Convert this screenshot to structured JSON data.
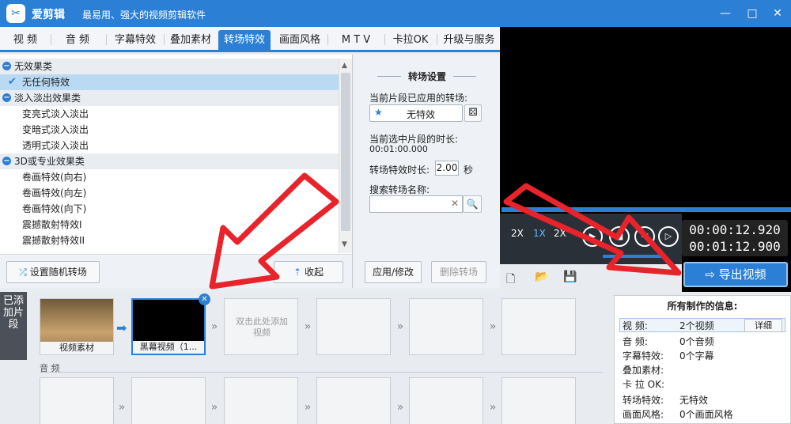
{
  "app": {
    "name": "爱剪辑",
    "slogan": "最易用、强大的视频剪辑软件"
  },
  "tabs": [
    "视 频",
    "音 频",
    "字幕特效",
    "叠加素材",
    "转场特效",
    "画面风格",
    "M T V",
    "卡拉OK",
    "升级与服务"
  ],
  "effects": {
    "group1": "无效果类",
    "g1_items": [
      "无任何特效"
    ],
    "group2": "淡入淡出效果类",
    "g2_items": [
      "变亮式淡入淡出",
      "变暗式淡入淡出",
      "透明式淡入淡出"
    ],
    "group3": "3D或专业效果类",
    "g3_items": [
      "卷画特效(向右)",
      "卷画特效(向左)",
      "卷画特效(向下)",
      "震撼散射特效I",
      "震撼散射特效II"
    ]
  },
  "buttons": {
    "random": "设置随机转场",
    "collapse": "收起",
    "apply": "应用/修改",
    "delete": "删除转场",
    "export": "导出视频",
    "detail": "详细"
  },
  "settings": {
    "title": "转场设置",
    "applied_label": "当前片段已应用的转场:",
    "applied_value": "无特效",
    "duration_label": "当前选中片段的时长:",
    "duration_value": "00:01:00.000",
    "effect_dur_label": "转场特效时长:",
    "effect_dur_value": "2.00",
    "sec": "秒",
    "search_label": "搜索转场名称:"
  },
  "player": {
    "time_current": "00:00:12.920",
    "time_total": "00:01:12.900",
    "speeds": [
      "2X",
      "1X",
      "2X"
    ]
  },
  "timeline": {
    "side_label": "已添加片段",
    "clip1": "视频素材",
    "clip2": "黑幕视频（1...",
    "add_hint": "双击此处添加视频",
    "audio_label": "音 频"
  },
  "info": {
    "title": "所有制作的信息:",
    "rows": [
      {
        "k": "视    频:",
        "v": "2个视频"
      },
      {
        "k": "音    频:",
        "v": "0个音频"
      },
      {
        "k": "字幕特效:",
        "v": "0个字幕"
      },
      {
        "k": "叠加素材:",
        "v": ""
      },
      {
        "k": "卡 拉 OK:",
        "v": ""
      },
      {
        "k": "转场特效:",
        "v": "无特效"
      },
      {
        "k": "画面风格:",
        "v": "0个画面风格"
      }
    ]
  },
  "colors": {
    "accent": "#2b7fd4",
    "arrow": "#e8232a"
  }
}
